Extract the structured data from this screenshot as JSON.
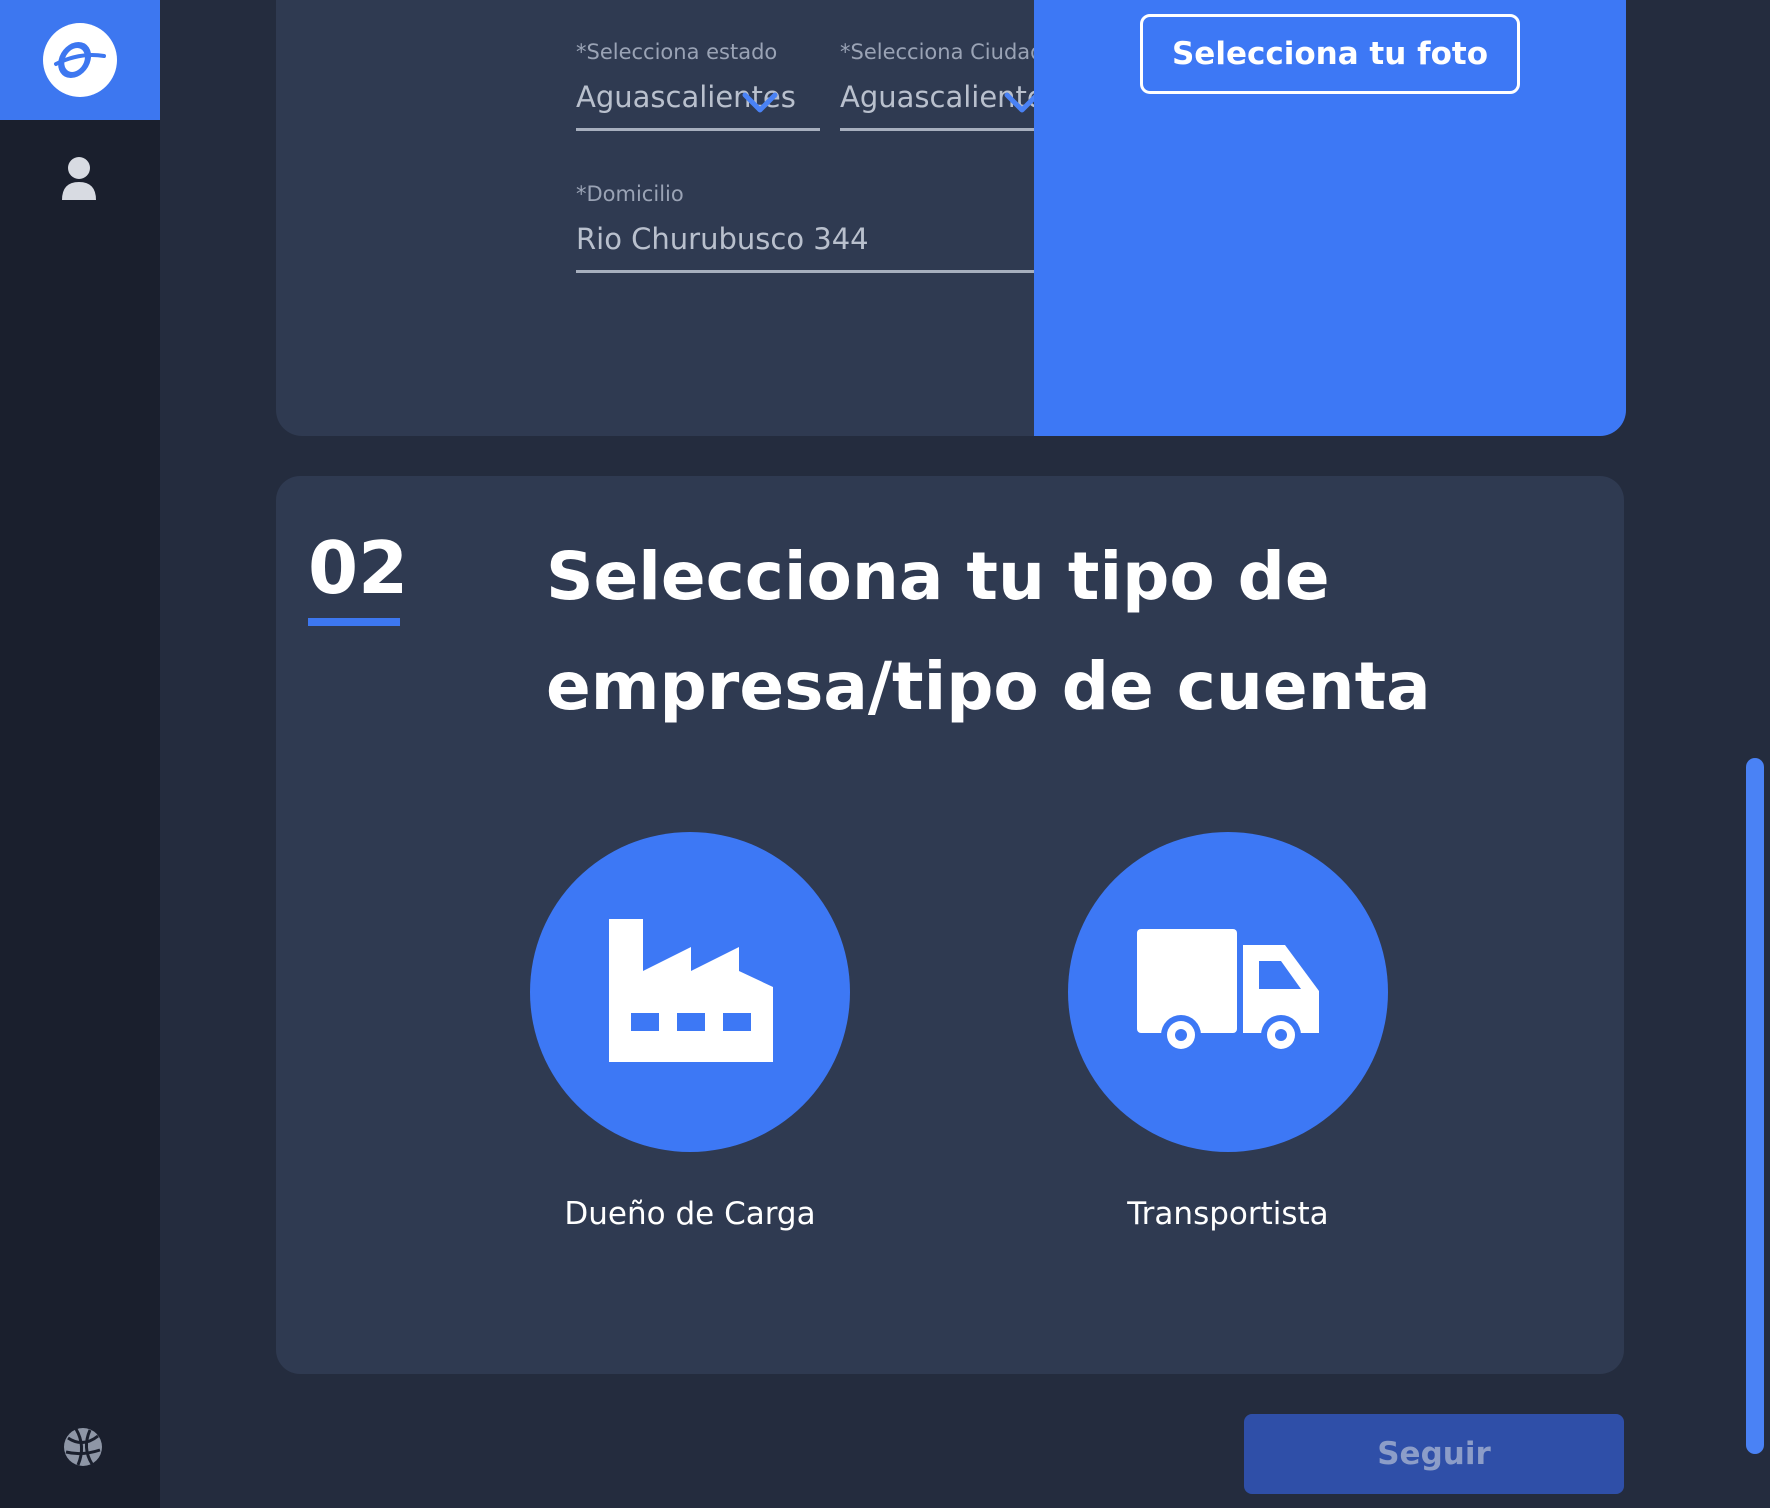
{
  "app": {
    "logo_icon": "app-logo-icon",
    "accent": "#3d77f0"
  },
  "sidebar": {
    "items": [
      {
        "icon": "user-icon"
      },
      {
        "icon": "globe-icon"
      }
    ]
  },
  "form": {
    "state": {
      "label": "*Selecciona estado",
      "value": "Aguascalientes"
    },
    "city": {
      "label": "*Selecciona Ciudad",
      "value": "Aguascalientes"
    },
    "address": {
      "label": "*Domicilio",
      "value": "Rio Churubusco 344"
    },
    "photo_button": "Selecciona tu foto"
  },
  "section2": {
    "number": "02",
    "title": "Selecciona tu tipo de empresa/tipo de cuenta",
    "options": [
      {
        "label": "Dueño de Carga",
        "icon": "factory-icon"
      },
      {
        "label": "Transportista",
        "icon": "truck-icon"
      }
    ]
  },
  "footer": {
    "next_button": "Seguir"
  }
}
